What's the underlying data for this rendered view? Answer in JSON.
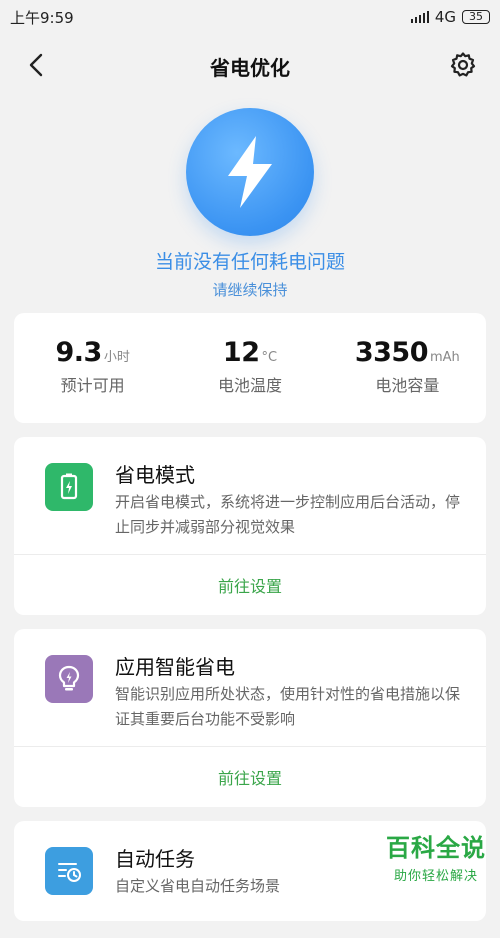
{
  "status_bar": {
    "time": "上午9:59",
    "network": "4G",
    "battery": "35"
  },
  "nav": {
    "title": "省电优化",
    "back_icon": "back-chevron-icon",
    "settings_icon": "gear-icon"
  },
  "hero": {
    "icon": "lightning-bolt-icon",
    "title": "当前没有任何耗电问题",
    "subtitle": "请继续保持"
  },
  "stats": [
    {
      "value": "9.3",
      "unit": "小时",
      "label": "预计可用"
    },
    {
      "value": "12",
      "unit": "°C",
      "label": "电池温度"
    },
    {
      "value": "3350",
      "unit": "mAh",
      "label": "电池容量"
    }
  ],
  "features": [
    {
      "title": "省电模式",
      "description": "开启省电模式，系统将进一步控制应用后台活动，停止同步并减弱部分视觉效果",
      "action": "前往设置",
      "icon": "battery-charge-icon",
      "icon_color": "#2fb86a"
    },
    {
      "title": "应用智能省电",
      "description": "智能识别应用所处状态，使用针对性的省电措施以保证其重要后台功能不受影响",
      "action": "前往设置",
      "icon": "lightbulb-icon",
      "icon_color": "#9a78b8"
    },
    {
      "title": "自动任务",
      "description": "自定义省电自动任务场景",
      "icon": "schedule-list-icon",
      "icon_color": "#3d9ee0"
    }
  ],
  "watermark": {
    "main": "百科全说",
    "sub": "助你轻松解决"
  }
}
